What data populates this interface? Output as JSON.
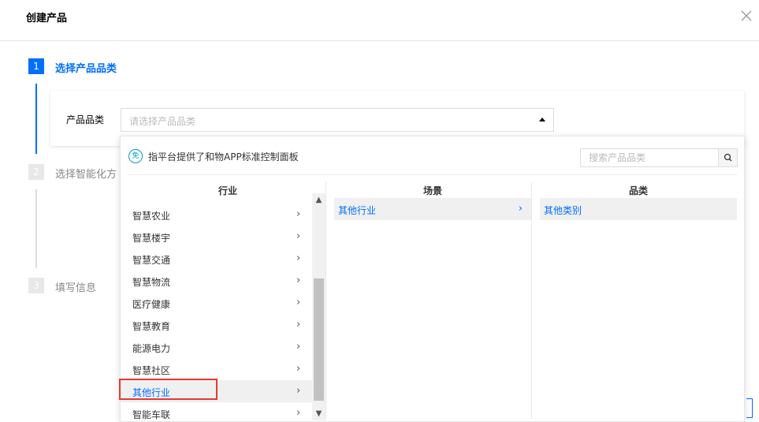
{
  "dialog": {
    "title": "创建产品"
  },
  "steps": [
    {
      "num": "1",
      "label": "选择产品品类"
    },
    {
      "num": "2",
      "label": "选择智能化方"
    },
    {
      "num": "3",
      "label": "填写信息"
    }
  ],
  "form": {
    "category_label": "产品品类",
    "category_placeholder": "请选择产品品类"
  },
  "dropdown": {
    "notice_icon_text": "免",
    "notice": "指平台提供了和物APP标准控制面板",
    "search_placeholder": "搜索产品品类",
    "columns": {
      "industry": "行业",
      "scene": "场景",
      "category": "品类"
    },
    "industries": [
      "智慧农业",
      "智慧楼宇",
      "智慧交通",
      "智慧物流",
      "医疗健康",
      "智慧教育",
      "能源电力",
      "智慧社区",
      "其他行业",
      "智能车联"
    ],
    "selected_industry": "其他行业",
    "scenes": [
      "其他行业"
    ],
    "categories": [
      "其他类别"
    ]
  },
  "colors": {
    "accent": "#006eff",
    "highlight_box": "#e53935"
  },
  "icons": [
    "close-icon",
    "free-badge-icon",
    "search-icon",
    "chevron-right-icon",
    "caret-up-icon",
    "scroll-up-icon",
    "scroll-down-icon"
  ]
}
